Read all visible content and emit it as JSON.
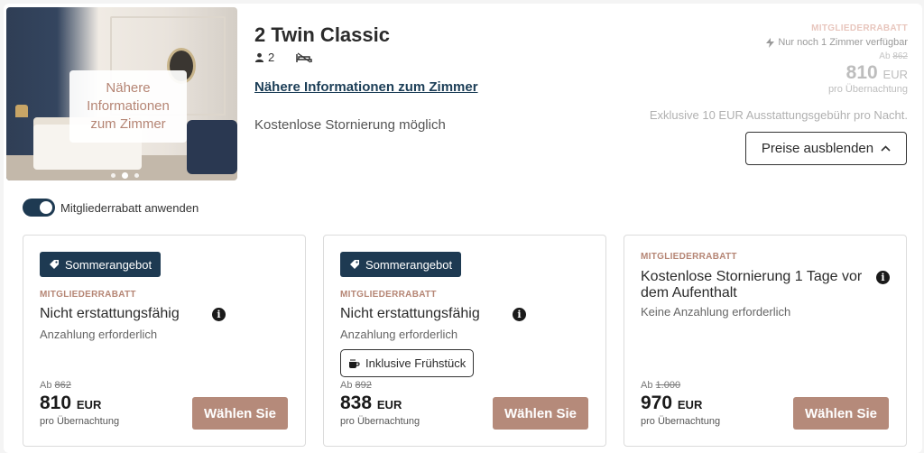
{
  "room": {
    "image_overlay_label": "Nähere Informationen zum Zimmer",
    "title": "2 Twin Classic",
    "guests": "2",
    "details_link": "Nähere Informationen zum Zimmer",
    "cancellation": "Kostenlose Stornierung möglich"
  },
  "price_summary": {
    "member_label": "MITGLIEDERRABATT",
    "availability": "Nur noch 1 Zimmer verfügbar",
    "from_label": "Ab",
    "old_price": "862",
    "price": "810",
    "currency": "EUR",
    "per_night": "pro Übernachtung",
    "fee_note": "Exklusive 10 EUR Ausstattungsgebühr pro Nacht.",
    "hide_prices_label": "Preise ausblenden"
  },
  "member_toggle": {
    "label": "Mitgliederrabatt anwenden",
    "enabled": true
  },
  "rates": [
    {
      "badge": "Sommerangebot",
      "member_label": "MITGLIEDERRABATT",
      "title": "Nicht erstattungsfähig",
      "subtitle": "Anzahlung erforderlich",
      "from_label": "Ab",
      "old_price": "862",
      "price": "810",
      "currency": "EUR",
      "per_night": "pro Übernachtung",
      "button": "Wählen Sie"
    },
    {
      "badge": "Sommerangebot",
      "member_label": "MITGLIEDERRABATT",
      "title": "Nicht erstattungsfähig",
      "subtitle": "Anzahlung erforderlich",
      "inclusion": "Inklusive Frühstück",
      "from_label": "Ab",
      "old_price": "892",
      "price": "838",
      "currency": "EUR",
      "per_night": "pro Übernachtung",
      "button": "Wählen Sie"
    },
    {
      "member_label": "MITGLIEDERRABATT",
      "title": "Kostenlose Stornierung 1 Tage vor dem Aufenthalt",
      "subtitle": "Keine Anzahlung erforderlich",
      "from_label": "Ab",
      "old_price": "1.000",
      "price": "970",
      "currency": "EUR",
      "per_night": "pro Übernachtung",
      "button": "Wählen Sie"
    }
  ],
  "colors": {
    "navy": "#1e3a52",
    "accent_rose": "#b58a7a",
    "member_label": "#b58574"
  }
}
